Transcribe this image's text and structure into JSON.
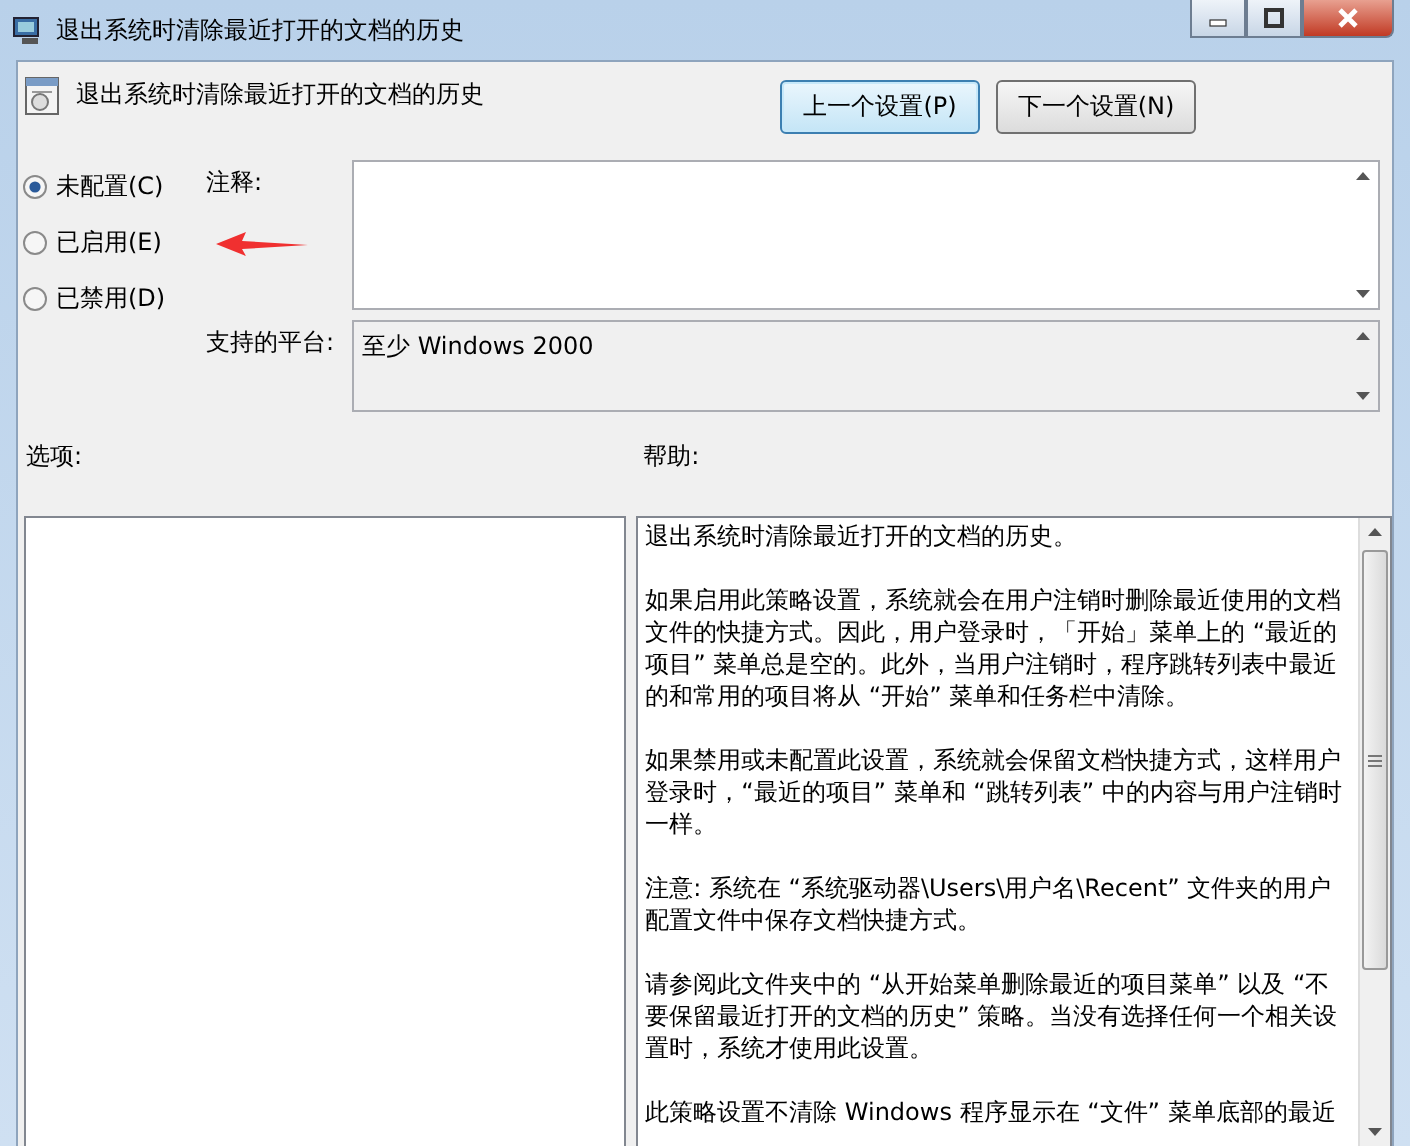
{
  "window": {
    "title": "退出系统时清除最近打开的文档的历史"
  },
  "policy_title": "退出系统时清除最近打开的文档的历史",
  "nav_buttons": [
    {
      "label": "上一个设置(P)",
      "focused": true
    },
    {
      "label": "下一个设置(N)",
      "focused": false
    }
  ],
  "state_options": [
    {
      "label": "未配置(C)",
      "selected": true
    },
    {
      "label": "已启用(E)",
      "selected": false
    },
    {
      "label": "已禁用(D)",
      "selected": false
    }
  ],
  "comment": {
    "label": "注释:"
  },
  "platform": {
    "label": "支持的平台:",
    "value": "至少 Windows 2000"
  },
  "options": {
    "label": "选项:"
  },
  "help": {
    "label": "帮助:",
    "paragraphs": [
      "退出系统时清除最近打开的文档的历史。",
      "如果启用此策略设置，系统就会在用户注销时删除最近使用的文档文件的快捷方式。因此，用户登录时，「开始」菜单上的 “最近的项目” 菜单总是空的。此外，当用户注销时，程序跳转列表中最近的和常用的项目将从 “开始” 菜单和任务栏中清除。",
      "如果禁用或未配置此设置，系统就会保留文档快捷方式，这样用户登录时，“最近的项目” 菜单和 “跳转列表” 中的内容与用户注销时一样。",
      "注意: 系统在 “系统驱动器\\Users\\用户名\\Recent” 文件夹的用户配置文件中保存文档快捷方式。",
      "请参阅此文件夹中的 “从开始菜单删除最近的项目菜单” 以及 “不要保留最近打开的文档的历史” 策略。当没有选择任何一个相关设置时，系统才使用此设置。",
      "此策略设置不清除 Windows 程序显示在 “文件” 菜单底部的最近"
    ]
  }
}
